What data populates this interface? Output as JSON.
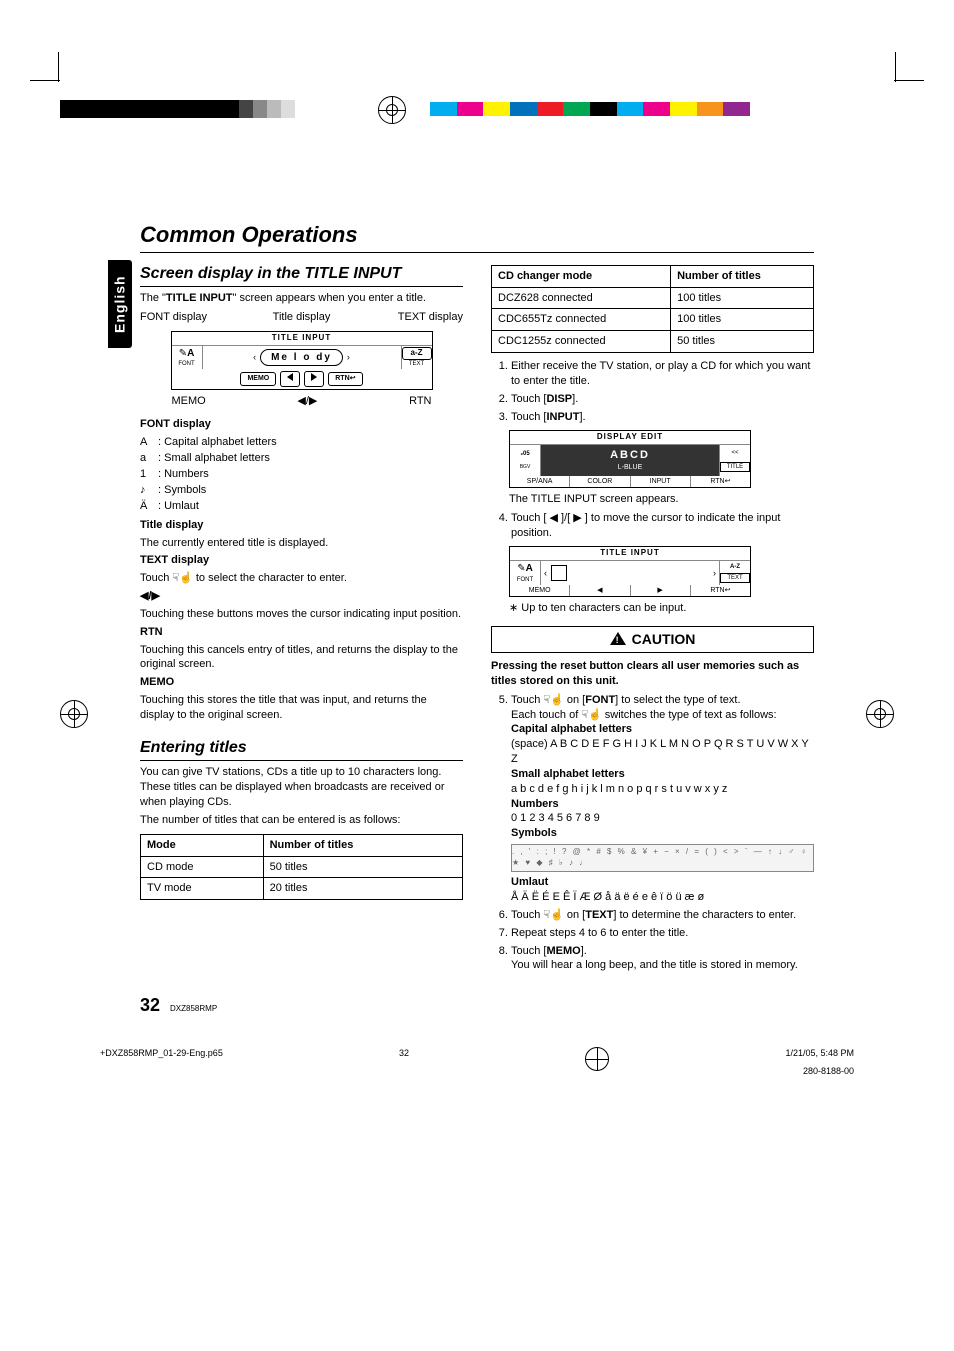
{
  "language_tab": "English",
  "h1": "Common Operations",
  "left": {
    "h2a": "Screen display in the TITLE INPUT",
    "intro_a": "The \"",
    "intro_b": "TITLE INPUT",
    "intro_c": "\" screen appears when you enter a title.",
    "labels": {
      "font": "FONT display",
      "title": "Title display",
      "text": "TEXT display"
    },
    "lcd1": {
      "header": "TITLE INPUT",
      "entry": "Me l o dy",
      "left_top": "A",
      "left_mid": "FONT",
      "right_top": "a-Z",
      "right_mid": "TEXT",
      "b1": "MEMO",
      "b4": "RTN↩"
    },
    "under": {
      "l": "MEMO",
      "c": "◀/▶",
      "r": "RTN"
    },
    "font_h": "FONT display",
    "font_rows": [
      {
        "k": "A",
        "v": ": Capital alphabet letters"
      },
      {
        "k": "a",
        "v": ": Small alphabet letters"
      },
      {
        "k": "1",
        "v": ": Numbers"
      },
      {
        "k": "♪",
        "v": ": Symbols"
      },
      {
        "k": "Ä",
        "v": ": Umlaut"
      }
    ],
    "title_h": "Title display",
    "title_p": "The currently entered title is displayed.",
    "text_h": "TEXT display",
    "text_p": "Touch ☟☝ to select the character to enter.",
    "arrows_h": "◀/▶",
    "arrows_p": "Touching these buttons moves the cursor indicating input position.",
    "rtn_h": "RTN",
    "rtn_p": "Touching this cancels entry of titles, and returns the display to the original screen.",
    "memo_h": "MEMO",
    "memo_p": "Touching this stores the title that was input, and returns the display to the original screen.",
    "h2b": "Entering titles",
    "enter_p1": "You can give TV stations, CDs a title up to 10 characters long. These titles can be displayed when broadcasts are received or when playing CDs.",
    "enter_p2": "The number of titles that can be entered is as follows:",
    "table1": {
      "h1": "Mode",
      "h2": "Number of titles",
      "r1a": "CD mode",
      "r1b": "50 titles",
      "r2a": "TV mode",
      "r2b": "20 titles"
    }
  },
  "right": {
    "table2": {
      "h1": "CD changer mode",
      "h2": "Number of titles",
      "rows": [
        {
          "a": "DCZ628 connected",
          "b": "100 titles"
        },
        {
          "a": "CDC655Tz connected",
          "b": "100 titles"
        },
        {
          "a": "CDC1255z connected",
          "b": "50 titles"
        }
      ]
    },
    "steps_a": [
      {
        "n": "1.",
        "t": "Either receive the TV station, or play a CD for which you want to enter the title."
      },
      {
        "n": "2.",
        "t_a": "Touch [",
        "t_b": "DISP",
        "t_c": "]."
      },
      {
        "n": "3.",
        "t_a": "Touch [",
        "t_b": "INPUT",
        "t_c": "]."
      }
    ],
    "lcd2": {
      "header": "DISPLAY EDIT",
      "time": "₂05",
      "title": "ABCD",
      "sub": "L-BLUE",
      "right": "<<",
      "rlab": "TITLE",
      "bot": [
        "SP/ANA",
        "COLOR",
        "INPUT",
        "RTN↩"
      ]
    },
    "after_lcd2": "The TITLE INPUT screen appears.",
    "step4": "Touch [ ◀ ]/[ ▶ ] to move the cursor to indicate the input position.",
    "lcd3": {
      "header": "TITLE INPUT",
      "left": "A",
      "leftlab": "FONT",
      "right": "A-Z",
      "rlab": "TEXT",
      "bot": [
        "MEMO",
        "◀",
        "▶",
        "RTN↩"
      ]
    },
    "note": "Up to ten characters can be input.",
    "caution": "CAUTION",
    "caution_p": "Pressing the reset button clears all user memories such as titles stored on this unit.",
    "step5_a": "Touch ☟☝ on [",
    "step5_b": "FONT",
    "step5_c": "] to select the type of text.",
    "step5_2": "Each touch of ☟☝ switches the type of text as follows:",
    "cap_h": "Capital alphabet letters",
    "cap_v": "(space) A B C D E F G H I J K L M N O P Q R S T U V W X Y Z",
    "small_h": "Small alphabet letters",
    "small_v": "a b c d e f g h i j k l m n o p q r s t u v w x y z",
    "num_h": "Numbers",
    "num_v": "0 1 2 3 4 5 6 7 8 9",
    "sym_h": "Symbols",
    "uml_h": "Umlaut",
    "uml_v": "Å Ä Ë É E Ê Ï Æ Ø å ä ë é e ê ï ö ü æ ø",
    "step6_a": "Touch ☟☝ on [",
    "step6_b": "TEXT",
    "step6_c": "] to determine the characters to enter.",
    "step7": "Repeat steps 4 to 6 to enter the title.",
    "step8_a": "Touch [",
    "step8_b": "MEMO",
    "step8_c": "].",
    "step8_2": "You will hear a long beep, and the title is stored in memory."
  },
  "footer": {
    "page": "32",
    "model": "DXZ858RMP"
  },
  "printfoot": {
    "file": "+DXZ858RMP_01-29-Eng.p65",
    "pg": "32",
    "date": "1/21/05, 5:48 PM",
    "code": "280-8188-00"
  }
}
